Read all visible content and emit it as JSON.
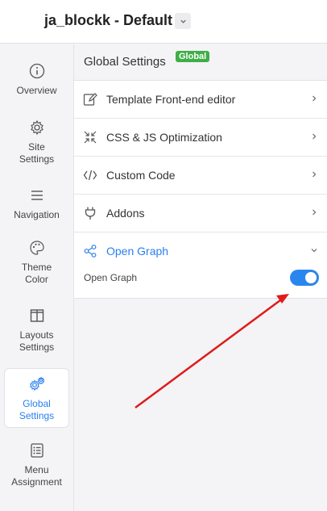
{
  "header": {
    "title": "ja_blockk - Default"
  },
  "sidebar": {
    "items": [
      {
        "label": "Overview",
        "icon": "info-icon"
      },
      {
        "label": "Site\nSettings",
        "icon": "gear-icon"
      },
      {
        "label": "Navigation",
        "icon": "menu-icon"
      },
      {
        "label": "Theme\nColor",
        "icon": "palette-icon"
      },
      {
        "label": "Layouts\nSettings",
        "icon": "layout-icon"
      },
      {
        "label": "Global\nSettings",
        "icon": "gears-icon",
        "active": true
      },
      {
        "label": "Menu\nAssignment",
        "icon": "list-icon"
      }
    ]
  },
  "panel": {
    "title": "Global Settings",
    "badge": "Global",
    "rows": [
      {
        "label": "Template Front-end editor",
        "icon": "edit-icon"
      },
      {
        "label": "CSS & JS Optimization",
        "icon": "compress-icon"
      },
      {
        "label": "Custom Code",
        "icon": "code-icon"
      },
      {
        "label": "Addons",
        "icon": "plug-icon"
      },
      {
        "label": "Open Graph",
        "icon": "share-icon",
        "expanded": true
      }
    ],
    "open_graph": {
      "field_label": "Open Graph",
      "enabled": true
    }
  },
  "colors": {
    "accent": "#2a7ff0",
    "badge": "#3fae48",
    "arrow": "#e01b1b"
  }
}
